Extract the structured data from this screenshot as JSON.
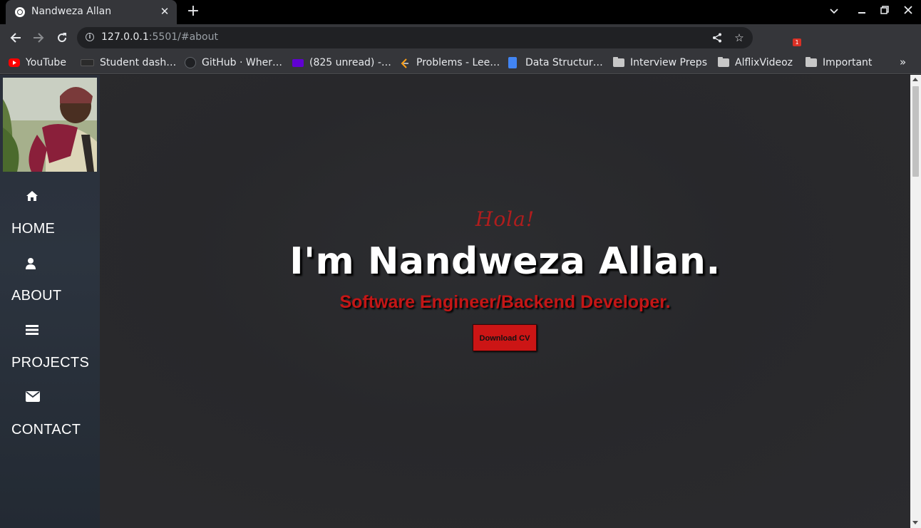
{
  "browser": {
    "tab": {
      "title": "Nandweza Allan",
      "favicon": "globe-icon",
      "close": "✕"
    },
    "new_tab": "+",
    "url": {
      "host": "127.0.0.1",
      "rest": ":5501/#about"
    },
    "bookmarks": [
      {
        "label": "YouTube",
        "icon": "youtube-icon",
        "color": "#ff0000"
      },
      {
        "label": "Student dash…",
        "icon": "student-dash-icon",
        "color": "#3c4043"
      },
      {
        "label": "GitHub · Wher…",
        "icon": "github-icon",
        "color": "#202124"
      },
      {
        "label": "(825 unread) -…",
        "icon": "mail-icon",
        "color": "#6001d2"
      },
      {
        "label": "Problems - Lee…",
        "icon": "leetcode-icon",
        "color": "#ffa116"
      },
      {
        "label": "Data Structur…",
        "icon": "doc-icon",
        "color": "#4285f4"
      },
      {
        "label": "Interview Preps",
        "icon": "folder-icon",
        "color": "#c7c7c7"
      },
      {
        "label": "AlflixVideoz",
        "icon": "folder-icon",
        "color": "#c7c7c7"
      },
      {
        "label": "Important",
        "icon": "folder-icon",
        "color": "#c7c7c7"
      }
    ],
    "bookmarks_more": "»"
  },
  "sidebar": {
    "items": [
      {
        "label": "HOME",
        "icon": "home-icon",
        "glyph": "⌂"
      },
      {
        "label": "ABOUT",
        "icon": "user-icon",
        "glyph": ""
      },
      {
        "label": "PROJECTS",
        "icon": "bars-icon",
        "glyph": "≡"
      },
      {
        "label": "CONTACT",
        "icon": "envelope-icon",
        "glyph": "✉"
      }
    ]
  },
  "hero": {
    "greeting": "Hola!",
    "name": "I'm Nandweza Allan.",
    "role": "Software Engineer/Backend Developer.",
    "cta": "Download CV"
  },
  "colors": {
    "accent": "#c41616",
    "sidebar_bg": "#2c343f",
    "hero_bg": "#2a2a2d"
  }
}
